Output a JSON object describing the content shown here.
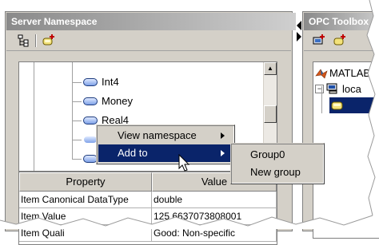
{
  "left_panel": {
    "title": "Server Namespace",
    "tree_items": [
      {
        "label": "Int4"
      },
      {
        "label": "Money"
      },
      {
        "label": "Real4"
      },
      {
        "label": "Re"
      },
      {
        "label": "UI"
      }
    ],
    "properties": {
      "headers": [
        "Property",
        "Value"
      ],
      "rows": [
        [
          "Item Canonical DataType",
          "double"
        ],
        [
          "Item Value",
          "125.6637073808001"
        ],
        [
          "Item Quali",
          "Good: Non-specific"
        ]
      ]
    }
  },
  "right_panel": {
    "title": "OPC Toolbox",
    "tree_items": [
      {
        "label": "MATLAB"
      },
      {
        "label": "loca"
      }
    ]
  },
  "context_menu": {
    "items": [
      {
        "label": "View namespace"
      },
      {
        "label": "Add to"
      }
    ]
  },
  "submenu": {
    "items": [
      {
        "label": "Group0"
      },
      {
        "label": "New group"
      }
    ]
  },
  "icons": {
    "tree_toggle": "hierarchy-view-icon",
    "add_item": "add-item-icon",
    "item": "namespace-item-icon",
    "matlab": "matlab-logo-icon",
    "host": "computer-host-icon",
    "group": "group-icon",
    "pointer": "mouse-pointer-icon"
  },
  "colors": {
    "selection": "#0a246a",
    "titlebar_dark": "#8a8a8a",
    "panel_face": "#d4d0c8"
  }
}
